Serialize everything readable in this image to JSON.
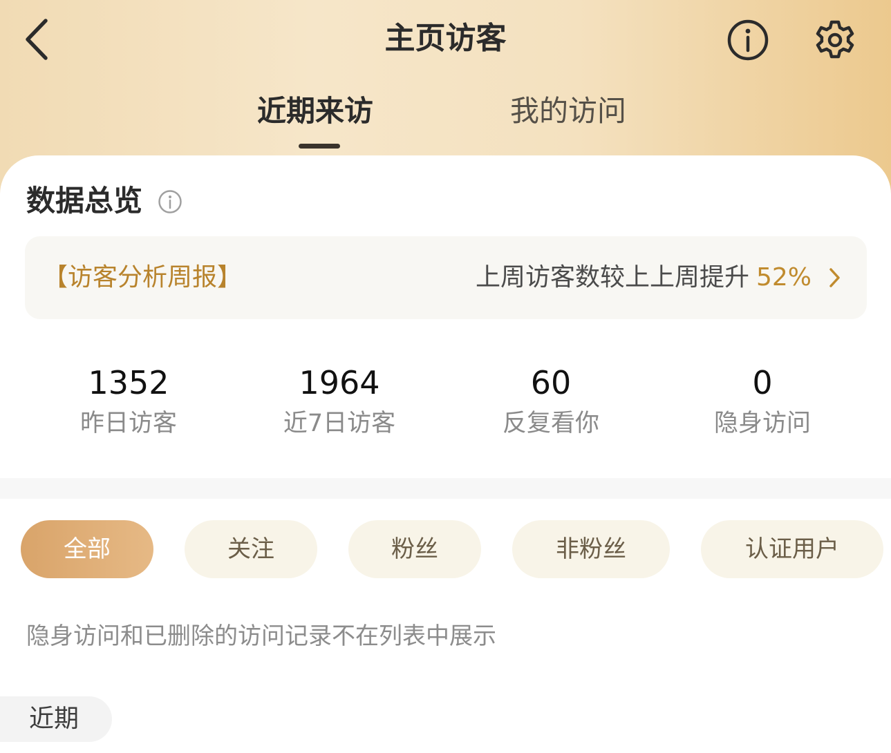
{
  "header": {
    "title": "主页访客",
    "tabs": [
      {
        "label": "近期来访",
        "active": true
      },
      {
        "label": "我的访问",
        "active": false
      }
    ]
  },
  "overview": {
    "title": "数据总览",
    "report": {
      "tag": "【访客分析周报】",
      "text": "上周访客数较上上周提升",
      "percent": "52%"
    },
    "stats": [
      {
        "value": "1352",
        "label": "昨日访客"
      },
      {
        "value": "1964",
        "label": "近7日访客"
      },
      {
        "value": "60",
        "label": "反复看你"
      },
      {
        "value": "0",
        "label": "隐身访问"
      }
    ]
  },
  "filters": [
    {
      "label": "全部",
      "active": true
    },
    {
      "label": "关注",
      "active": false
    },
    {
      "label": "粉丝",
      "active": false
    },
    {
      "label": "非粉丝",
      "active": false
    },
    {
      "label": "认证用户",
      "active": false
    }
  ],
  "notice": "隐身访问和已删除的访问记录不在列表中展示",
  "list": {
    "section_label": "近期"
  },
  "colors": {
    "accent": "#c08b2e",
    "active_chip": "#d9a46a",
    "header_gradient_start": "#f1dbb4",
    "header_gradient_end": "#ecc98e"
  },
  "icons": {
    "back": "chevron-left-icon",
    "info": "info-circle-icon",
    "settings": "gear-icon",
    "report_arrow": "chevron-right-icon"
  }
}
